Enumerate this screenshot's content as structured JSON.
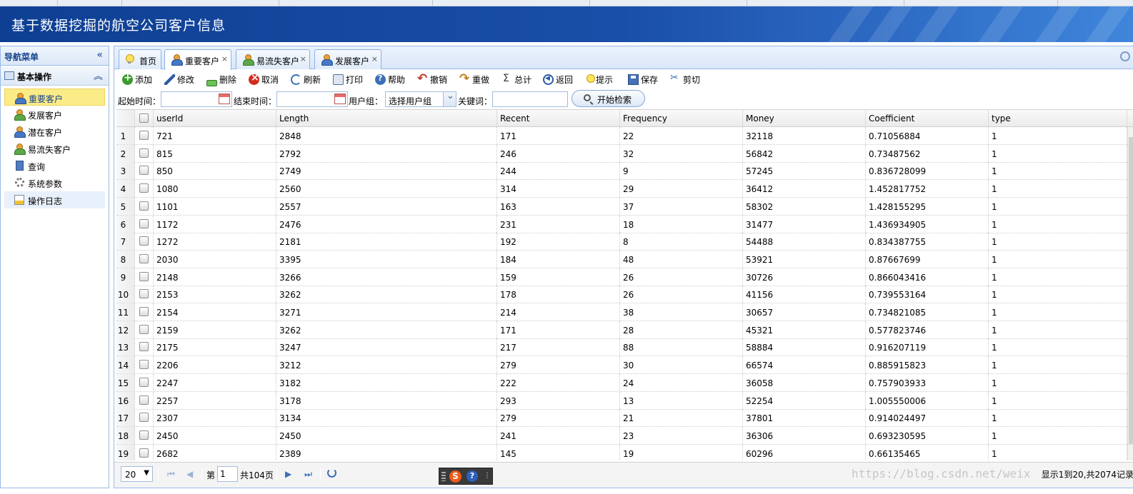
{
  "header": {
    "title": "基于数据挖掘的航空公司客户信息"
  },
  "nav": {
    "title": "导航菜单",
    "group": "基本操作",
    "items": [
      {
        "label": "重要客户",
        "icon": "customers-icon"
      },
      {
        "label": "发展客户",
        "icon": "customers-icon"
      },
      {
        "label": "潜在客户",
        "icon": "customers-icon"
      },
      {
        "label": "易流失客户",
        "icon": "customers-icon"
      },
      {
        "label": "查询",
        "icon": "book-icon"
      },
      {
        "label": "系统参数",
        "icon": "gear-icon"
      },
      {
        "label": "操作日志",
        "icon": "log-icon"
      }
    ]
  },
  "tabs": [
    {
      "label": "首页"
    },
    {
      "label": "重要客户",
      "close": "×"
    },
    {
      "label": "易流失客户",
      "close": "×"
    },
    {
      "label": "发展客户",
      "close": "×"
    }
  ],
  "toolbar": [
    "添加",
    "修改",
    "删除",
    "取消",
    "刷新",
    "打印",
    "帮助",
    "撤销",
    "重做",
    "总计",
    "返回",
    "提示",
    "保存",
    "剪切"
  ],
  "search": {
    "start_label": "起始时间：",
    "end_label": "结束时间：",
    "group_label": "用户组：",
    "group_value": "选择用户组",
    "keyword_label": "关键词：",
    "search_button": "开始检索"
  },
  "grid": {
    "columns": [
      "userId",
      "Length",
      "Recent",
      "Frequency",
      "Money",
      "Coefficient",
      "type"
    ],
    "rows": [
      [
        "1",
        "721",
        "2848",
        "171",
        "22",
        "32118",
        "0.71056884",
        "1"
      ],
      [
        "2",
        "815",
        "2792",
        "246",
        "32",
        "56842",
        "0.73487562",
        "1"
      ],
      [
        "3",
        "850",
        "2749",
        "244",
        "9",
        "57245",
        "0.836728099",
        "1"
      ],
      [
        "4",
        "1080",
        "2560",
        "314",
        "29",
        "36412",
        "1.452817752",
        "1"
      ],
      [
        "5",
        "1101",
        "2557",
        "163",
        "37",
        "58302",
        "1.428155295",
        "1"
      ],
      [
        "6",
        "1172",
        "2476",
        "231",
        "18",
        "31477",
        "1.436934905",
        "1"
      ],
      [
        "7",
        "1272",
        "2181",
        "192",
        "8",
        "54488",
        "0.834387755",
        "1"
      ],
      [
        "8",
        "2030",
        "3395",
        "184",
        "48",
        "53921",
        "0.87667699",
        "1"
      ],
      [
        "9",
        "2148",
        "3266",
        "159",
        "26",
        "30726",
        "0.866043416",
        "1"
      ],
      [
        "10",
        "2153",
        "3262",
        "178",
        "26",
        "41156",
        "0.739553164",
        "1"
      ],
      [
        "11",
        "2154",
        "3271",
        "214",
        "38",
        "30657",
        "0.734821085",
        "1"
      ],
      [
        "12",
        "2159",
        "3262",
        "171",
        "28",
        "45321",
        "0.577823746",
        "1"
      ],
      [
        "13",
        "2175",
        "3247",
        "217",
        "88",
        "58884",
        "0.916207119",
        "1"
      ],
      [
        "14",
        "2206",
        "3212",
        "279",
        "30",
        "66574",
        "0.885915823",
        "1"
      ],
      [
        "15",
        "2247",
        "3182",
        "222",
        "24",
        "36058",
        "0.757903933",
        "1"
      ],
      [
        "16",
        "2257",
        "3178",
        "293",
        "13",
        "52254",
        "1.005550006",
        "1"
      ],
      [
        "17",
        "2307",
        "3134",
        "279",
        "21",
        "37801",
        "0.914024497",
        "1"
      ],
      [
        "18",
        "2450",
        "2450",
        "241",
        "23",
        "36306",
        "0.693230595",
        "1"
      ],
      [
        "19",
        "2682",
        "2389",
        "145",
        "19",
        "60296",
        "0.66135465",
        "1"
      ]
    ]
  },
  "pager": {
    "page_size": "20",
    "page_prefix": "第",
    "page_value": "1",
    "page_total": "共104页",
    "info": "显示1到20,共2074记录"
  },
  "ime": {
    "logo": "S",
    "help": "?"
  },
  "watermark": "https://blog.csdn.net/weix"
}
